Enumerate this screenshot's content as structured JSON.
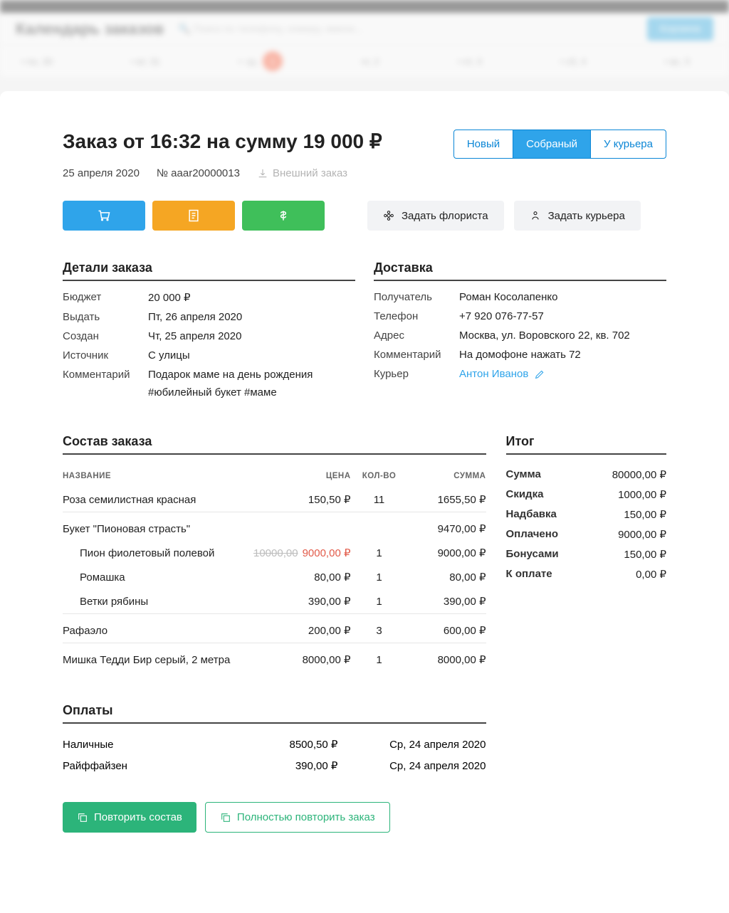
{
  "bg": {
    "title": "Календарь заказов",
    "search": "Поиск по телефону, номеру, имени...",
    "cart": "Корзина",
    "days": [
      "пн, 30",
      "вт, 31",
      "ср,",
      "1",
      "чт, 2",
      "пт, 3",
      "сб, 4",
      "вс, 5"
    ]
  },
  "title": "Заказ от 16:32 на сумму 19 000 ₽",
  "date": "25 апреля 2020",
  "num": "№ aaar20000013",
  "ext": "Внешний заказ",
  "status": {
    "a": "Новый",
    "b": "Собраный",
    "c": "У курьера"
  },
  "assign": {
    "florist": "Задать флориста",
    "courier": "Задать курьера"
  },
  "details": {
    "title": "Детали заказа",
    "k": {
      "budget": "Бюджет",
      "due": "Выдать",
      "created": "Создан",
      "src": "Источник",
      "comment": "Комментарий"
    },
    "v": {
      "budget": "20 000 ₽",
      "due": "Пт, 26 апреля 2020",
      "created": "Чт, 25 апреля 2020",
      "src": "С улицы",
      "comment": "Подарок маме на день рождения",
      "tags": "#юбилейный букет #маме"
    }
  },
  "delivery": {
    "title": "Доставка",
    "k": {
      "recipient": "Получатель",
      "phone": "Телефон",
      "addr": "Адрес",
      "comment": "Комментарий",
      "courier": "Курьер"
    },
    "v": {
      "recipient": "Роман Косолапенко",
      "phone": "+7 920 076-77-57",
      "addr": "Москва, ул. Воровского 22, кв. 702",
      "comment": "На домофоне нажать 72",
      "courier": "Антон Иванов"
    }
  },
  "comp": {
    "title": "Состав заказа",
    "cols": {
      "name": "НАЗВАНИЕ",
      "price": "ЦЕНА",
      "qty": "КОЛ-ВО",
      "sum": "СУММА"
    },
    "rows": {
      "r1": {
        "name": "Роза семилистная красная",
        "price": "150,50 ₽",
        "qty": "11",
        "sum": "1655,50 ₽"
      },
      "r2": {
        "name": "Букет \"Пионовая страсть\"",
        "sum": "9470,00 ₽"
      },
      "r2a": {
        "name": "Пион фиолетовый полевой",
        "old": "10000,00",
        "new": "9000,00 ₽",
        "qty": "1",
        "sum": "9000,00 ₽"
      },
      "r2b": {
        "name": "Ромашка",
        "price": "80,00 ₽",
        "qty": "1",
        "sum": "80,00 ₽"
      },
      "r2c": {
        "name": "Ветки рябины",
        "price": "390,00 ₽",
        "qty": "1",
        "sum": "390,00 ₽"
      },
      "r3": {
        "name": "Рафаэло",
        "price": "200,00 ₽",
        "qty": "3",
        "sum": "600,00 ₽"
      },
      "r4": {
        "name": "Мишка Тедди Бир серый, 2 метра",
        "price": "8000,00 ₽",
        "qty": "1",
        "sum": "8000,00 ₽"
      }
    }
  },
  "totals": {
    "title": "Итог",
    "rows": {
      "sum": {
        "l": "Сумма",
        "v": "80000,00 ₽"
      },
      "disc": {
        "l": "Скидка",
        "v": "1000,00 ₽"
      },
      "sur": {
        "l": "Надбавка",
        "v": "150,00 ₽"
      },
      "paid": {
        "l": "Оплачено",
        "v": "9000,00 ₽"
      },
      "bonus": {
        "l": "Бонусами",
        "v": "150,00 ₽"
      },
      "due": {
        "l": "К оплате",
        "v": "0,00 ₽"
      }
    }
  },
  "payments": {
    "title": "Оплаты",
    "p1": {
      "name": "Наличные",
      "amt": "8500,50 ₽",
      "date": "Ср, 24 апреля 2020"
    },
    "p2": {
      "name": "Райффайзен",
      "amt": "390,00 ₽",
      "date": "Ср, 24 апреля 2020"
    }
  },
  "repeat": {
    "a": "Повторить состав",
    "b": "Полностью повторить заказ"
  }
}
